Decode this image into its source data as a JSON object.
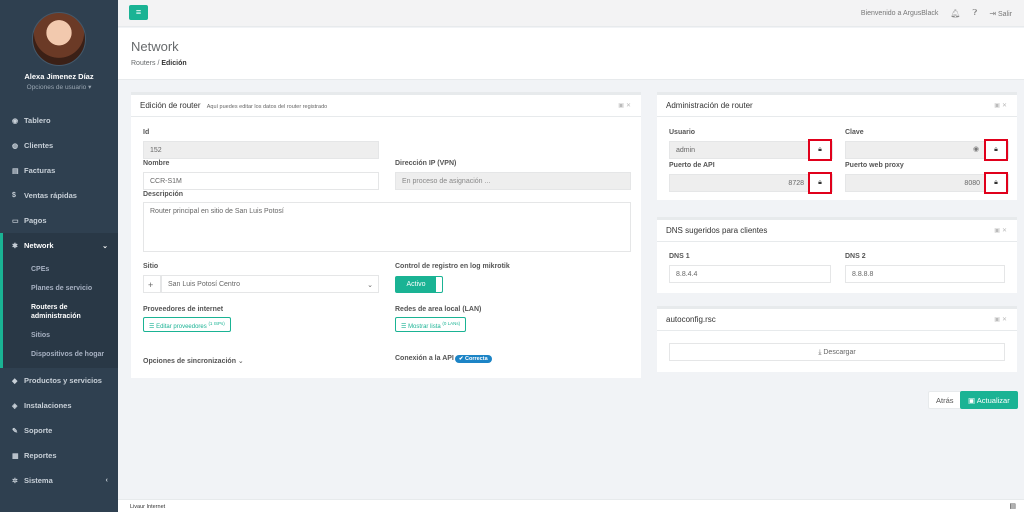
{
  "user": {
    "name": "Alexa Jimenez Díaz",
    "options": "Opciones de usuario"
  },
  "menu": [
    {
      "label": "Tablero",
      "icon": "dashboard-icon",
      "glyph": "◉"
    },
    {
      "label": "Clientes",
      "icon": "users-icon",
      "glyph": "◍"
    },
    {
      "label": "Facturas",
      "icon": "invoice-icon",
      "glyph": "▤"
    },
    {
      "label": "Ventas rápidas",
      "icon": "dollar-icon",
      "glyph": "$"
    },
    {
      "label": "Pagos",
      "icon": "money-icon",
      "glyph": "▭"
    },
    {
      "label": "Network",
      "icon": "network-icon",
      "glyph": "✱"
    }
  ],
  "network_sub": [
    "CPEs",
    "Planes de servicio",
    "Routers de administración",
    "Sitios",
    "Dispositivos de hogar"
  ],
  "menu_after": [
    {
      "label": "Productos y servicios",
      "icon": "products-icon",
      "glyph": "◆"
    },
    {
      "label": "Instalaciones",
      "icon": "install-icon",
      "glyph": "◈"
    },
    {
      "label": "Soporte",
      "icon": "wrench-icon",
      "glyph": "✎"
    },
    {
      "label": "Reportes",
      "icon": "reports-icon",
      "glyph": "▦"
    },
    {
      "label": "Sistema",
      "icon": "cogs-icon",
      "glyph": "✲"
    }
  ],
  "topbar": {
    "welcome": "Bienvenido a ArgusBlack",
    "logout": "Salir"
  },
  "header": {
    "title": "Network",
    "crumb1": "Routers",
    "crumb2": "Edición"
  },
  "edit": {
    "title": "Edición de router",
    "subtitle": "Aquí puedes editar los datos del router registrado",
    "id_label": "Id",
    "id_value": "152",
    "name_label": "Nombre",
    "name_value": "CCR-S1M",
    "ip_label": "Dirección IP (VPN)",
    "ip_value": "En proceso de asignación ...",
    "desc_label": "Descripción",
    "desc_value": "Router principal en sitio de San Luis Potosí",
    "site_label": "Sitio",
    "site_value": "San Luis Potosí Centro",
    "log_label": "Control de registro en log mikrotik",
    "log_value": "Activo",
    "isp_label": "Proveedores de internet",
    "isp_btn": "Editar proveedores",
    "isp_count": "(1 ISPs)",
    "lan_label": "Redes de area local (LAN)",
    "lan_btn": "Mostrar lista",
    "lan_count": "(0 LANs)",
    "sync_label": "Opciones de sincronización",
    "conn_label": "Conexión a la API",
    "conn_badge": "Correcta"
  },
  "admin": {
    "title": "Administración de router",
    "user_label": "Usuario",
    "user_value": "admin",
    "pass_label": "Clave",
    "api_label": "Puerto de API",
    "api_value": "8728",
    "proxy_label": "Puerto web proxy",
    "proxy_value": "8080"
  },
  "dns": {
    "title": "DNS sugeridos para clientes",
    "dns1_label": "DNS 1",
    "dns1_value": "8.8.4.4",
    "dns2_label": "DNS 2",
    "dns2_value": "8.8.8.8"
  },
  "autoconfig": {
    "title": "autoconfig.rsc",
    "download": "Descargar"
  },
  "actions": {
    "back": "Atrás",
    "update": "Actualizar"
  },
  "footer": "Livaur Internet"
}
